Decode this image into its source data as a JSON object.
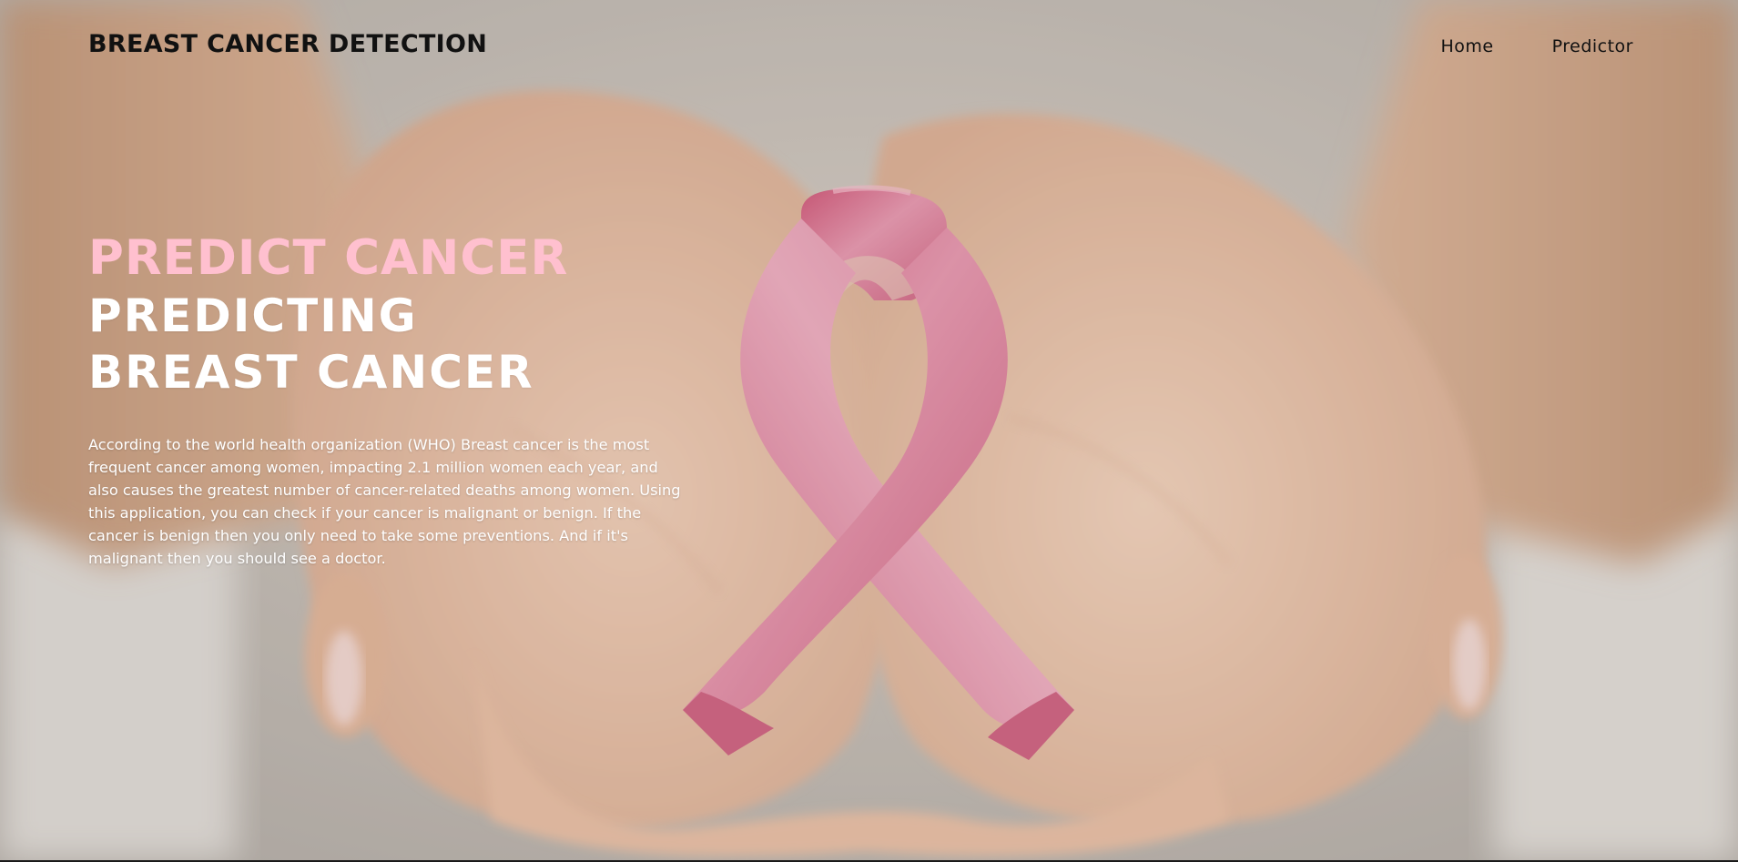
{
  "header": {
    "brand": "BREAST CANCER DETECTION",
    "nav": {
      "home": "Home",
      "predictor": "Predictor"
    }
  },
  "hero": {
    "kicker": "PREDICT CANCER",
    "title": "PREDICTING BREAST CANCER",
    "description": "According to the world health organization (WHO) Breast cancer is the most frequent cancer among women, impacting 2.1 million women each year, and also causes the greatest number of cancer-related deaths among women. Using this application, you can check if your cancer is malignant or benign. If the cancer is benign then you only need to take some preventions. And if it's malignant then you should see a doctor."
  },
  "colors": {
    "kicker": "#ffc0cf",
    "ribbon": "#d9567e",
    "text_dark": "#111111",
    "text_light": "#ffffff"
  },
  "background": {
    "subject": "cupped hands holding pink awareness ribbon",
    "icon": "pink-ribbon-icon"
  }
}
